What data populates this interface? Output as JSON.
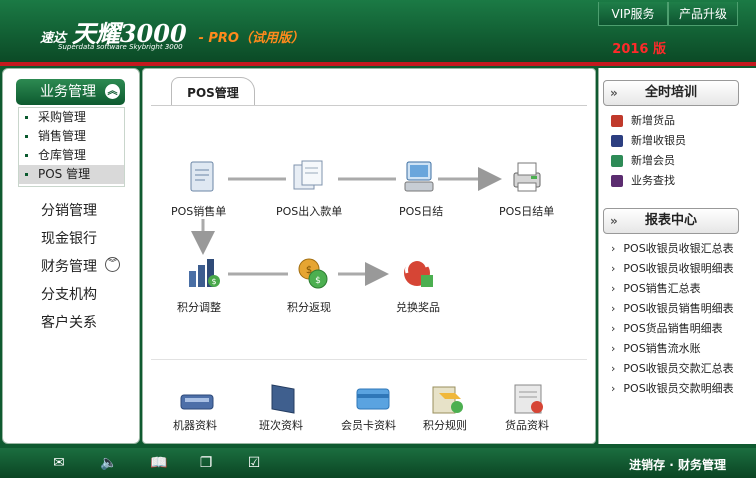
{
  "header": {
    "brand_prefix": "速达",
    "brand_name": "天耀3000",
    "pro_label": "- PRO（试用版）",
    "subtitle": "Superdata software Skybright 3000",
    "buttons": [
      "VIP服务",
      "产品升级"
    ],
    "edition": "2016 版"
  },
  "sidebar": {
    "active_group": "业务管理",
    "sub_items": [
      "采购管理",
      "销售管理",
      "仓库管理",
      "POS 管理"
    ],
    "selected_sub": "POS 管理",
    "groups": [
      "分销管理",
      "现金银行",
      "财务管理",
      "分支机构",
      "客户关系"
    ]
  },
  "center": {
    "tab": "POS管理",
    "flow": [
      "POS销售单",
      "POS出入款单",
      "POS日结",
      "POS日结单",
      "积分调整",
      "积分返现",
      "兑换奖品"
    ],
    "bottom": [
      "机器资料",
      "班次资料",
      "会员卡资料",
      "积分规则",
      "货品资料"
    ]
  },
  "right": {
    "training": {
      "title": "全时培训",
      "items": [
        {
          "label": "新增货品",
          "icon": "add-goods-icon",
          "color": "#c0392b"
        },
        {
          "label": "新增收银员",
          "icon": "add-cashier-icon",
          "color": "#2c3e80"
        },
        {
          "label": "新增会员",
          "icon": "add-member-icon",
          "color": "#2e8b57"
        },
        {
          "label": "业务查找",
          "icon": "business-search-icon",
          "color": "#5b2c6f"
        }
      ]
    },
    "reports": {
      "title": "报表中心",
      "items": [
        "POS收银员收银汇总表",
        "POS收银员收银明细表",
        "POS销售汇总表",
        "POS收银员销售明细表",
        "POS货品销售明细表",
        "POS销售流水账",
        "POS收银员交款汇总表",
        "POS收银员交款明细表"
      ]
    }
  },
  "footer": {
    "icons": [
      "mail-icon",
      "sound-icon",
      "book-icon",
      "window-icon",
      "check-icon"
    ],
    "caption": "进销存 · 财务管理"
  }
}
